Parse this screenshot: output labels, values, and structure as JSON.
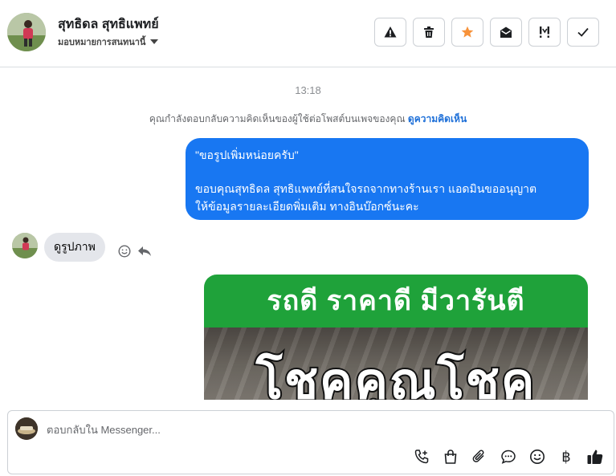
{
  "header": {
    "contact_name": "สุทธิดล สุทธิแพทย์",
    "assign_label": "มอบหมายการสนทนานี้"
  },
  "toolbar": {
    "buttons": [
      {
        "name": "report-button",
        "icon": "warning-icon"
      },
      {
        "name": "delete-button",
        "icon": "trash-icon"
      },
      {
        "name": "star-button",
        "icon": "star-icon"
      },
      {
        "name": "mark-unread-button",
        "icon": "envelope-open-icon"
      },
      {
        "name": "important-button",
        "icon": "exclamation-icon"
      },
      {
        "name": "done-button",
        "icon": "check-icon"
      }
    ]
  },
  "conversation": {
    "timestamp": "13:18",
    "notice_text": "คุณกำลังตอบกลับความคิดเห็นของผู้ใช้ต่อโพสต์บนเพจของคุณ",
    "notice_link": "ดูความคิดเห็น",
    "outgoing": {
      "quote": "\"ขอรูปเพิ่มหน่อยครับ\"",
      "line1": "ขอบคุณสุทธิดล สุทธิแพทย์ที่สนใจรถจากทางร้านเรา แอดมินขออนุญาต",
      "line2": "ให้ข้อมูลรายละเอียดพิ่มเติม ทางอินบ๊อกซ์นะคะ"
    },
    "incoming": {
      "text": "ดูรูปภาพ"
    },
    "image": {
      "banner_text": "รถดี  ราคาดี  มีวารันตี",
      "overlay_text": "โชคคูณโชค"
    }
  },
  "composer": {
    "placeholder": "ตอบกลับใน Messenger...",
    "currency_symbol": "฿"
  },
  "colors": {
    "accent": "#1877f2",
    "star": "#f7923a",
    "banner_green": "#1fa23a"
  }
}
